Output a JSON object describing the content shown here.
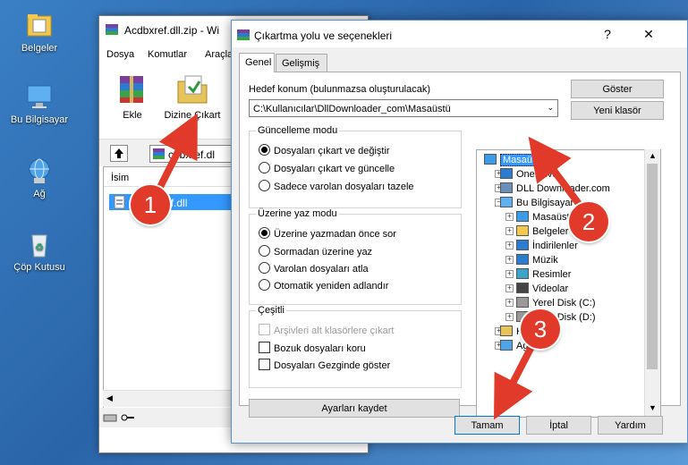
{
  "desktop": {
    "icons": [
      {
        "label": "Belgeler",
        "icon": "folder-documents-icon"
      },
      {
        "label": "Bu Bilgisayar",
        "icon": "computer-icon"
      },
      {
        "label": "Ağ",
        "icon": "network-icon"
      },
      {
        "label": "Çöp Kutusu",
        "icon": "recycle-bin-icon"
      }
    ]
  },
  "winrar": {
    "title": "Acdbxref.dll.zip - Wi",
    "menu": [
      "Dosya",
      "Komutlar",
      "Araçla"
    ],
    "toolbar": {
      "add_label": "Ekle",
      "extract_label": "Dizine Çıkart"
    },
    "address": "cdbxref.dl",
    "list": {
      "header": "İsim",
      "file": "acdbxref.dll"
    }
  },
  "dialog": {
    "title": "Çıkartma yolu ve seçenekleri",
    "help_glyph": "?",
    "close_glyph": "✕",
    "tabs": [
      "Genel",
      "Gelişmiş"
    ],
    "destination": {
      "label": "Hedef konum (bulunmazsa oluşturulacak)",
      "value": "C:\\Kullanıcılar\\DllDownloader_com\\Masaüstü"
    },
    "show_button": "Göster",
    "new_folder_button": "Yeni klasör",
    "update_mode": {
      "title": "Güncelleme modu",
      "options": [
        "Dosyaları çıkart ve değiştir",
        "Dosyaları çıkart ve güncelle",
        "Sadece varolan dosyaları tazele"
      ],
      "selected": 0
    },
    "overwrite_mode": {
      "title": "Üzerine yaz modu",
      "options": [
        "Üzerine yazmadan önce sor",
        "Sormadan üzerine yaz",
        "Varolan dosyaları atla",
        "Otomatik yeniden adlandır"
      ],
      "selected": 0
    },
    "misc": {
      "title": "Çeşitli",
      "options": [
        "Arşivleri alt klasörlere çıkart",
        "Bozuk dosyaları koru",
        "Dosyaları Gezginde göster"
      ],
      "disabled": [
        true,
        false,
        false
      ]
    },
    "save_settings_button": "Ayarları kaydet",
    "tree": [
      {
        "label": "Masaüstü",
        "selected": true,
        "level": 0,
        "icon": "desktop-icon"
      },
      {
        "label": "OneDrive",
        "level": 1,
        "icon": "cloud-icon"
      },
      {
        "label": "DLL Downloader.com",
        "level": 1,
        "icon": "user-icon"
      },
      {
        "label": "Bu Bilgisayar",
        "level": 1,
        "icon": "computer-icon"
      },
      {
        "label": "Masaüstü",
        "level": 2,
        "icon": "desktop-icon"
      },
      {
        "label": "Belgeler",
        "level": 2,
        "icon": "documents-icon"
      },
      {
        "label": "İndirilenler",
        "level": 2,
        "icon": "download-icon"
      },
      {
        "label": "Müzik",
        "level": 2,
        "icon": "music-icon"
      },
      {
        "label": "Resimler",
        "level": 2,
        "icon": "pictures-icon"
      },
      {
        "label": "Videolar",
        "level": 2,
        "icon": "video-icon"
      },
      {
        "label": "Yerel Disk (C:)",
        "level": 2,
        "icon": "disk-icon"
      },
      {
        "label": "Yerel Disk (D:)",
        "level": 2,
        "icon": "disk-icon"
      },
      {
        "label": "Kitaplıklar",
        "level": 1,
        "icon": "library-icon"
      },
      {
        "label": "Ağ",
        "level": 1,
        "icon": "network-icon"
      }
    ],
    "buttons": {
      "ok": "Tamam",
      "cancel": "İptal",
      "help": "Yardım"
    }
  },
  "markers": [
    "1",
    "2",
    "3"
  ],
  "colors": {
    "accent": "#0078d7",
    "selection": "#3399ff",
    "marker": "#e23a2a"
  }
}
